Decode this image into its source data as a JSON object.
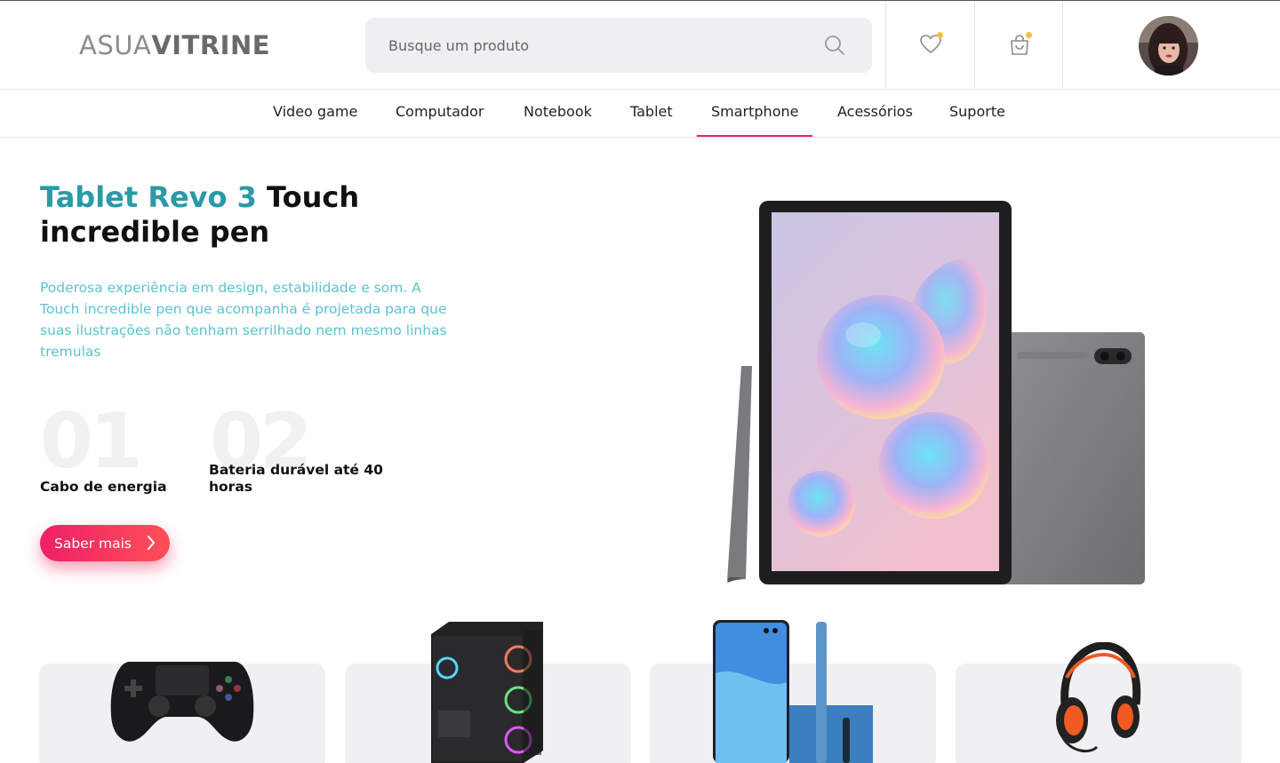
{
  "header": {
    "logo_light": "ASUA",
    "logo_bold": "VITRINE",
    "search_placeholder": "Busque um produto",
    "search_icon": "search-icon",
    "wishlist_icon": "heart-icon",
    "cart_icon": "shopping-bag-icon",
    "badge_color": "#f5c044"
  },
  "nav": {
    "items": [
      "Video game",
      "Computador",
      "Notebook",
      "Tablet",
      "Smartphone",
      "Acessórios",
      "Suporte"
    ],
    "active": "Smartphone",
    "active_color": "#e91e63"
  },
  "hero": {
    "title_accent": "Tablet Revo 3",
    "title_rest": "Touch incredible pen",
    "accent_color": "#2a9aa6",
    "description": "Poderosa experiência em design, estabilidade e som. A Touch incredible pen que acompanha é projetada para que suas ilustrações não tenham serrilhado nem mesmo linhas tremulas",
    "features": [
      {
        "number": "01",
        "label": "Cabo de energia"
      },
      {
        "number": "02",
        "label": "Bateria durável até 40 horas"
      }
    ],
    "cta_label": "Saber mais",
    "cta_icon": "chevron-right-icon"
  },
  "products": [
    {
      "name": "controller-image"
    },
    {
      "name": "pc-case-image"
    },
    {
      "name": "smartphone-image"
    },
    {
      "name": "headset-image"
    }
  ]
}
